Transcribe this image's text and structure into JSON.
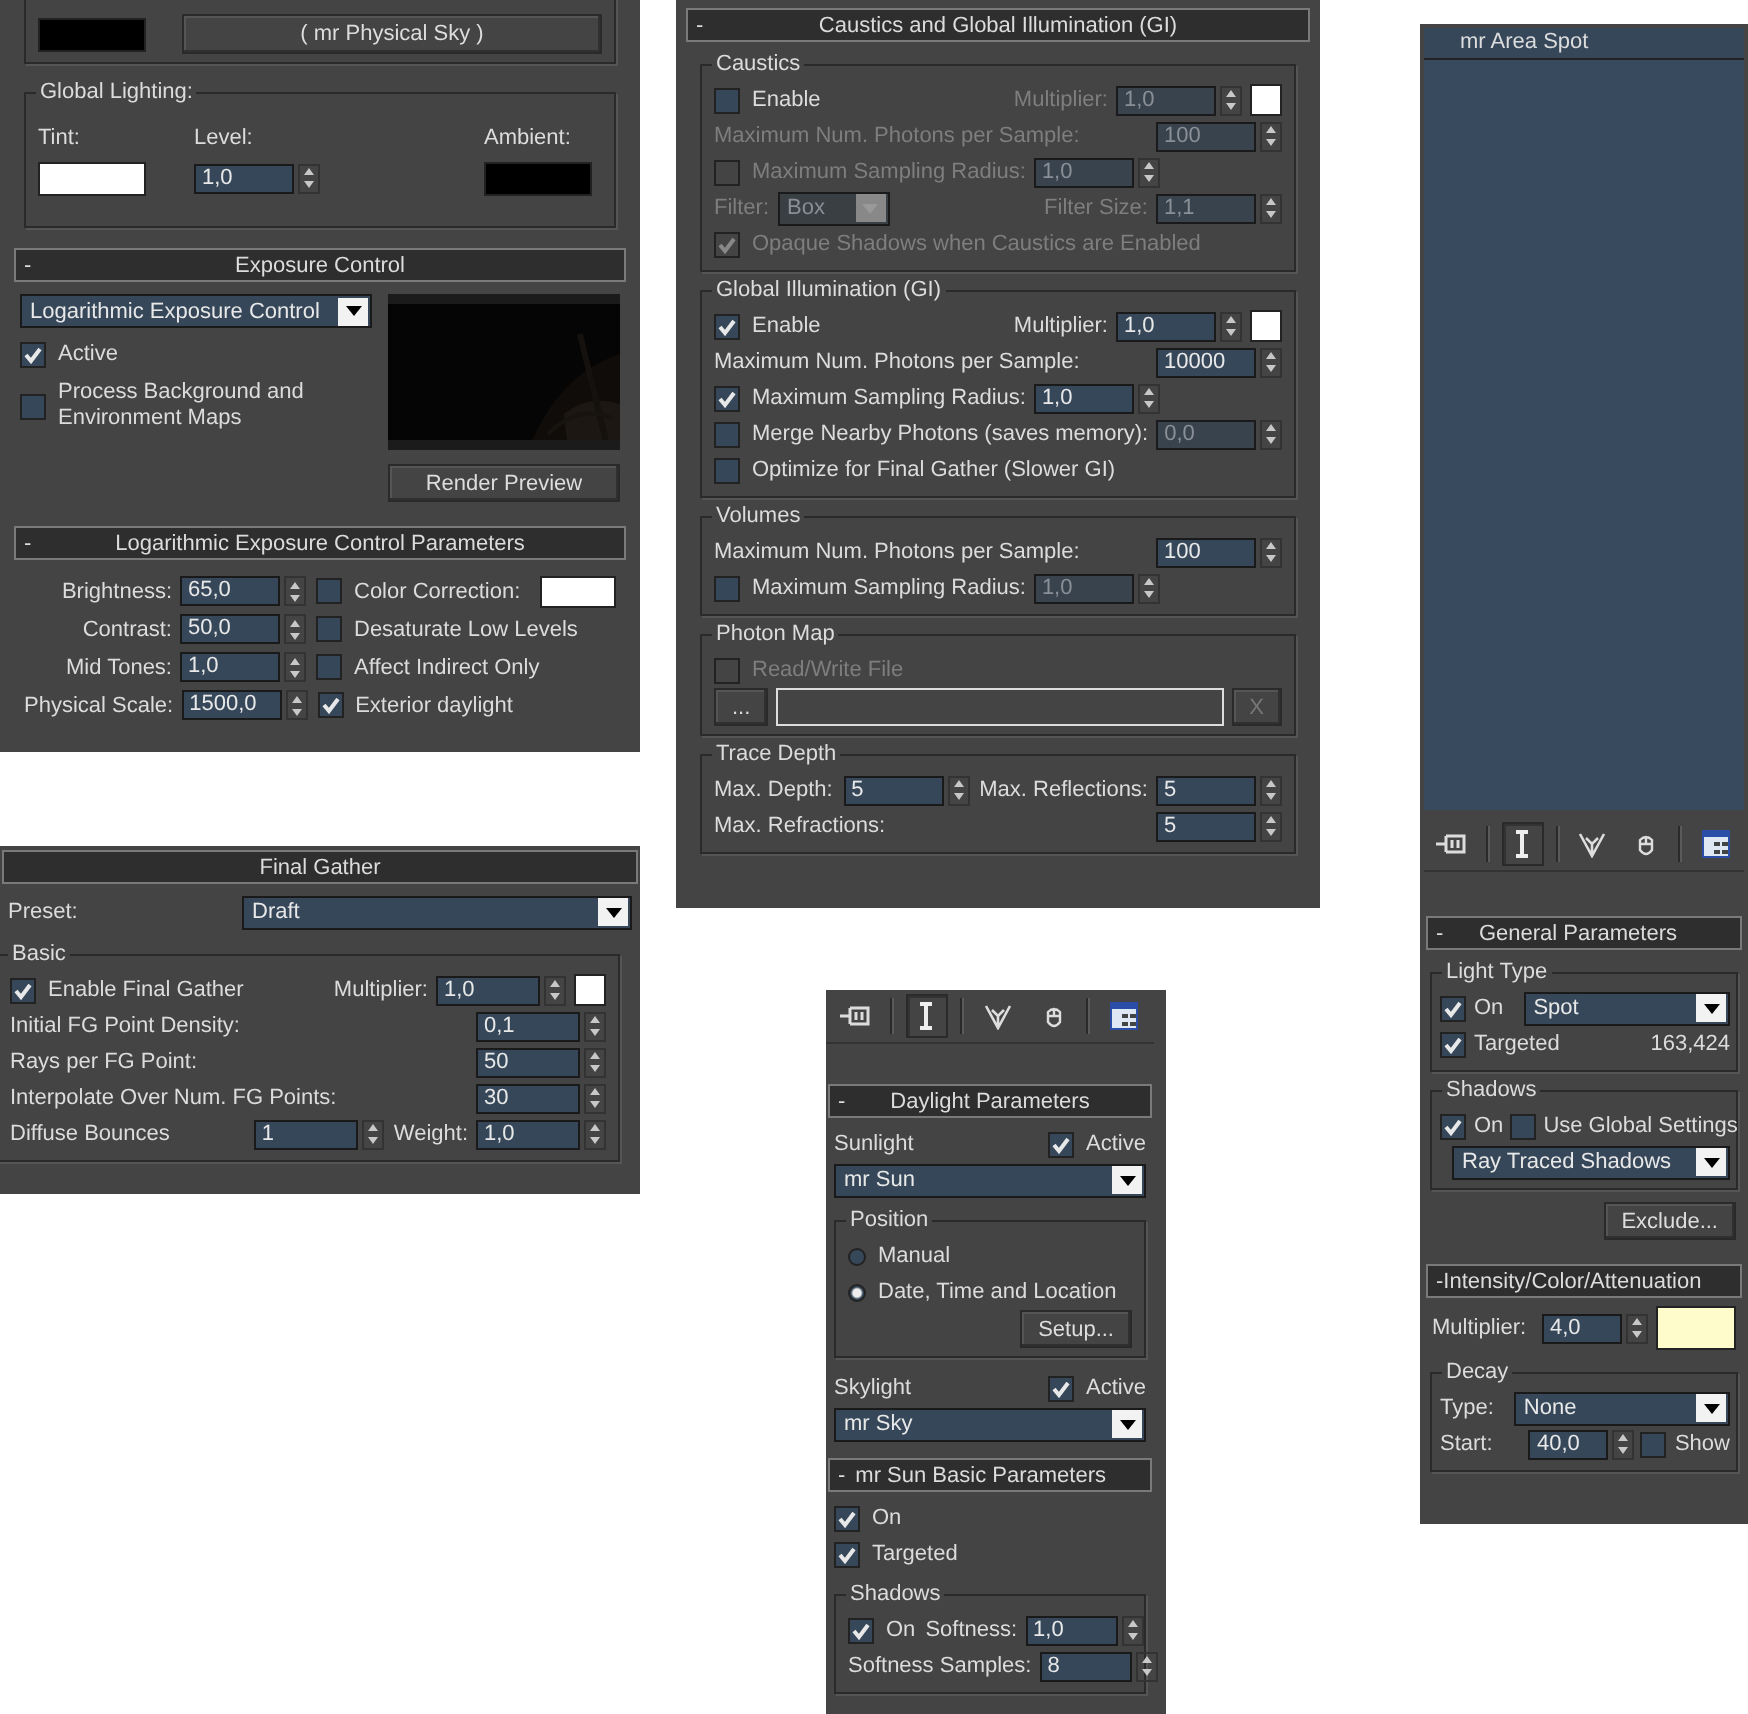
{
  "panels": [
    {
      "kind": "environment",
      "sections": [
        {
          "kind": "cut-group",
          "rows": [
            [
              {
                "kind": "swatch",
                "color": "#000000"
              },
              {
                "kind": "button",
                "label": "( mr Physical Sky )"
              }
            ]
          ]
        },
        {
          "kind": "column-group",
          "title": "Global Lighting:",
          "rows": [
            [
              {
                "kind": "label",
                "text": "Tint:"
              },
              {
                "kind": "label",
                "text": "Level:"
              },
              {
                "kind": "label",
                "text": "Ambient:"
              }
            ],
            [
              {
                "kind": "swatch",
                "color": "#ffffff"
              },
              {
                "kind": "spinner",
                "value": "1,0"
              },
              {
                "kind": "swatch",
                "color": "#000000"
              }
            ]
          ]
        },
        {
          "kind": "rollout",
          "toggle": "-",
          "title": "Exposure Control",
          "sections": [
            {
              "kind": "exposure",
              "dropdown": "Logarithmic Exposure Control",
              "options": [
                {
                  "kind": "checkbox",
                  "label": "Active",
                  "checked": true
                },
                {
                  "kind": "checkbox",
                  "label": "Process Background and Environment Maps",
                  "checked": false
                }
              ],
              "button": "Render Preview"
            }
          ]
        },
        {
          "kind": "rollout",
          "toggle": "-",
          "title": "Logarithmic Exposure Control Parameters",
          "sections": [
            {
              "kind": "pair-rows",
              "rows": [
                [
                  {
                    "kind": "label",
                    "text": "Brightness:"
                  },
                  {
                    "kind": "spinner",
                    "value": "65,0"
                  },
                  {
                    "kind": "checkbox",
                    "label": "Color Correction:",
                    "checked": false
                  },
                  {
                    "kind": "swatch",
                    "color": "#ffffff"
                  }
                ],
                [
                  {
                    "kind": "label",
                    "text": "Contrast:"
                  },
                  {
                    "kind": "spinner",
                    "value": "50,0"
                  },
                  {
                    "kind": "checkbox",
                    "label": "Desaturate Low Levels",
                    "checked": false
                  }
                ],
                [
                  {
                    "kind": "label",
                    "text": "Mid Tones:"
                  },
                  {
                    "kind": "spinner",
                    "value": "1,0"
                  },
                  {
                    "kind": "checkbox",
                    "label": "Affect Indirect Only",
                    "checked": false
                  }
                ],
                [
                  {
                    "kind": "label",
                    "text": "Physical Scale:"
                  },
                  {
                    "kind": "spinner",
                    "value": "1500,0"
                  },
                  {
                    "kind": "checkbox",
                    "label": "Exterior daylight",
                    "checked": true
                  }
                ]
              ]
            }
          ]
        }
      ]
    },
    {
      "kind": "final-gather",
      "sections": [
        {
          "kind": "rollout",
          "title": "Final Gather",
          "sections": [
            {
              "kind": "rows",
              "rows": [
                [
                  {
                    "kind": "label",
                    "text": "Preset:"
                  },
                  {
                    "kind": "dropdown",
                    "value": "Draft"
                  }
                ]
              ]
            },
            {
              "kind": "group",
              "title": "Basic",
              "rows": [
                [
                  {
                    "kind": "checkbox",
                    "label": "Enable Final Gather",
                    "checked": true
                  },
                  {
                    "kind": "label",
                    "text": "Multiplier:"
                  },
                  {
                    "kind": "spinner",
                    "value": "1,0"
                  },
                  {
                    "kind": "swatch",
                    "color": "#ffffff"
                  }
                ],
                [
                  {
                    "kind": "label",
                    "text": "Initial FG Point Density:"
                  },
                  {
                    "kind": "spinner",
                    "value": "0,1"
                  }
                ],
                [
                  {
                    "kind": "label",
                    "text": "Rays per FG Point:"
                  },
                  {
                    "kind": "spinner",
                    "value": "50"
                  }
                ],
                [
                  {
                    "kind": "label",
                    "text": "Interpolate Over Num. FG Points:"
                  },
                  {
                    "kind": "spinner",
                    "value": "30"
                  }
                ],
                [
                  {
                    "kind": "label",
                    "text": "Diffuse Bounces"
                  },
                  {
                    "kind": "spinner",
                    "value": "1"
                  },
                  {
                    "kind": "label",
                    "text": "Weight:"
                  },
                  {
                    "kind": "spinner",
                    "value": "1,0"
                  }
                ]
              ]
            }
          ]
        }
      ]
    },
    {
      "kind": "caustics",
      "sections": [
        {
          "kind": "rollout",
          "toggle": "-",
          "title": "Caustics and Global Illumination (GI)",
          "sections": [
            {
              "kind": "group",
              "title": "Caustics",
              "rows": [
                {
                  "items": [
                    {
                      "kind": "checkbox",
                      "label": "Enable",
                      "checked": false,
                      "disabled": false
                    },
                    {
                      "kind": "label",
                      "text": "Multiplier:",
                      "disabled": true
                    },
                    {
                      "kind": "spinner",
                      "value": "1,0",
                      "disabled": true
                    },
                    {
                      "kind": "swatch",
                      "color": "#ffffff"
                    }
                  ]
                },
                {
                  "items": [
                    {
                      "kind": "label",
                      "text": "Maximum Num. Photons per Sample:",
                      "disabled": true
                    },
                    {
                      "kind": "spinner",
                      "value": "100",
                      "disabled": true
                    }
                  ]
                },
                {
                  "items": [
                    {
                      "kind": "checkbox",
                      "label": "Maximum Sampling Radius:",
                      "checked": false,
                      "disabled": true
                    },
                    {
                      "kind": "spinner",
                      "value": "1,0",
                      "disabled": true
                    }
                  ]
                },
                {
                  "items": [
                    {
                      "kind": "label",
                      "text": "Filter:",
                      "disabled": true
                    },
                    {
                      "kind": "dropdown",
                      "value": "Box",
                      "disabled": true
                    },
                    {
                      "kind": "label",
                      "text": "Filter Size:",
                      "disabled": true
                    },
                    {
                      "kind": "spinner",
                      "value": "1,1",
                      "disabled": true
                    }
                  ]
                },
                {
                  "items": [
                    {
                      "kind": "checkbox",
                      "label": "Opaque Shadows when Caustics are Enabled",
                      "checked": true,
                      "disabled": true
                    }
                  ]
                }
              ]
            },
            {
              "kind": "group",
              "title": "Global Illumination (GI)",
              "rows": [
                {
                  "items": [
                    {
                      "kind": "checkbox",
                      "label": "Enable",
                      "checked": true,
                      "disabled": false
                    },
                    {
                      "kind": "label",
                      "text": "Multiplier:",
                      "disabled": false
                    },
                    {
                      "kind": "spinner",
                      "value": "1,0",
                      "disabled": false
                    },
                    {
                      "kind": "swatch",
                      "color": "#ffffff"
                    }
                  ]
                },
                {
                  "items": [
                    {
                      "kind": "label",
                      "text": "Maximum Num. Photons per Sample:",
                      "disabled": false
                    },
                    {
                      "kind": "spinner",
                      "value": "10000",
                      "disabled": false
                    }
                  ]
                },
                {
                  "items": [
                    {
                      "kind": "checkbox",
                      "label": "Maximum Sampling Radius:",
                      "checked": true,
                      "disabled": false
                    },
                    {
                      "kind": "spinner",
                      "value": "1,0",
                      "disabled": false
                    }
                  ]
                },
                {
                  "items": [
                    {
                      "kind": "checkbox",
                      "label": "Merge Nearby Photons (saves memory):",
                      "checked": false,
                      "disabled": false
                    },
                    {
                      "kind": "spinner",
                      "value": "0,0",
                      "disabled": true
                    }
                  ]
                },
                {
                  "items": [
                    {
                      "kind": "checkbox",
                      "label": "Optimize for Final Gather (Slower GI)",
                      "checked": false,
                      "disabled": false
                    }
                  ]
                }
              ]
            },
            {
              "kind": "group",
              "title": "Volumes",
              "rows": [
                {
                  "items": [
                    {
                      "kind": "label",
                      "text": "Maximum Num. Photons per Sample:",
                      "disabled": false
                    },
                    {
                      "kind": "spinner",
                      "value": "100",
                      "disabled": false
                    }
                  ]
                },
                {
                  "items": [
                    {
                      "kind": "checkbox",
                      "label": "Maximum Sampling Radius:",
                      "checked": false,
                      "disabled": false
                    },
                    {
                      "kind": "spinner",
                      "value": "1,0",
                      "disabled": true
                    }
                  ]
                }
              ]
            },
            {
              "kind": "group",
              "title": "Photon Map",
              "rows": [
                [
                  {
                    "kind": "checkbox",
                    "label": "Read/Write File",
                    "checked": false,
                    "disabled": true
                  }
                ],
                [
                  {
                    "kind": "button",
                    "label": "...",
                    "disabled": false
                  },
                  {
                    "kind": "field"
                  },
                  {
                    "kind": "button",
                    "label": "X",
                    "disabled": true
                  }
                ]
              ]
            },
            {
              "kind": "group",
              "title": "Trace Depth",
              "rows": [
                {
                  "items": [
                    {
                      "kind": "label",
                      "text": "Max. Depth:",
                      "disabled": false
                    },
                    {
                      "kind": "spinner",
                      "value": "5",
                      "disabled": false
                    },
                    {
                      "kind": "label",
                      "text": "Max. Reflections:",
                      "disabled": false
                    },
                    {
                      "kind": "spinner",
                      "value": "5",
                      "disabled": false
                    }
                  ]
                },
                {
                  "items": [
                    {
                      "kind": "label",
                      "text": "Max. Refractions:",
                      "disabled": false
                    },
                    {
                      "kind": "spinner",
                      "value": "5",
                      "disabled": false
                    }
                  ]
                }
              ]
            }
          ]
        }
      ]
    },
    {
      "kind": "daylight",
      "sections": [
        {
          "kind": "toolbar",
          "buttons": [
            {
              "selected": false
            },
            {
              "selected": true
            },
            {
              "selected": false
            },
            {
              "selected": false
            },
            {
              "selected": false
            }
          ]
        },
        {
          "kind": "rollout",
          "toggle": "-",
          "title": "Daylight Parameters",
          "sections": [
            {
              "kind": "rows",
              "rows": [
                [
                  {
                    "kind": "label",
                    "text": "Sunlight"
                  },
                  {
                    "kind": "checkbox",
                    "label": "Active",
                    "checked": true
                  }
                ],
                [
                  {
                    "kind": "dropdown",
                    "value": "mr Sun"
                  }
                ]
              ]
            },
            {
              "kind": "group",
              "title": "Position",
              "rows": [
                [
                  {
                    "kind": "radio",
                    "label": "Manual",
                    "selected": false
                  }
                ],
                [
                  {
                    "kind": "radio",
                    "label": "Date, Time and Location",
                    "selected": true
                  }
                ],
                [
                  {
                    "kind": "button",
                    "label": "Setup..."
                  }
                ]
              ]
            },
            {
              "kind": "rows",
              "rows": [
                [
                  {
                    "kind": "label",
                    "text": "Skylight"
                  },
                  {
                    "kind": "checkbox",
                    "label": "Active",
                    "checked": true
                  }
                ],
                [
                  {
                    "kind": "dropdown",
                    "value": "mr Sky"
                  }
                ]
              ]
            }
          ]
        },
        {
          "kind": "rollout",
          "toggle": "-",
          "title": "mr Sun Basic Parameters",
          "sections": [
            {
              "kind": "rows",
              "rows": [
                [
                  {
                    "kind": "checkbox",
                    "label": "On",
                    "checked": true
                  }
                ],
                [
                  {
                    "kind": "checkbox",
                    "label": "Targeted",
                    "checked": true
                  }
                ]
              ]
            },
            {
              "kind": "group",
              "title": "Shadows",
              "rows": [
                {
                  "items": [
                    {
                      "kind": "checkbox",
                      "label": "On",
                      "checked": true
                    },
                    {
                      "kind": "label",
                      "text": "Softness:"
                    },
                    {
                      "kind": "spinner",
                      "value": "1,0"
                    }
                  ]
                },
                {
                  "items": [
                    {
                      "kind": "label",
                      "text": "Softness Samples:"
                    },
                    {
                      "kind": "spinner",
                      "value": "8"
                    }
                  ]
                }
              ]
            }
          ]
        }
      ]
    },
    {
      "kind": "light",
      "sections": [
        {
          "kind": "object-name",
          "value": "mr Area Spot"
        },
        {
          "kind": "toolbar",
          "buttons": [
            {
              "selected": false
            },
            {
              "selected": true
            },
            {
              "selected": false
            },
            {
              "selected": false
            },
            {
              "selected": false
            }
          ]
        },
        {
          "kind": "rollout",
          "toggle": "-",
          "title": "General Parameters",
          "sections": [
            {
              "kind": "group",
              "title": "Light Type",
              "rows": [
                [
                  {
                    "kind": "checkbox",
                    "label": "On",
                    "checked": true
                  },
                  {
                    "kind": "dropdown",
                    "value": "Spot"
                  }
                ],
                [
                  {
                    "kind": "checkbox",
                    "label": "Targeted",
                    "checked": true
                  },
                  {
                    "kind": "label",
                    "text": "163,424"
                  }
                ]
              ]
            },
            {
              "kind": "group",
              "title": "Shadows",
              "rows": [
                [
                  {
                    "kind": "checkbox",
                    "label": "On",
                    "checked": true
                  },
                  {
                    "kind": "checkbox",
                    "label": "Use Global Settings",
                    "checked": false
                  }
                ],
                [
                  {
                    "kind": "dropdown",
                    "value": "Ray Traced Shadows"
                  }
                ]
              ]
            },
            {
              "kind": "rows",
              "rows": [
                [
                  {
                    "kind": "button",
                    "label": "Exclude..."
                  }
                ]
              ]
            }
          ]
        },
        {
          "kind": "rollout",
          "toggle": "-",
          "title": "Intensity/Color/Attenuation",
          "sections": [
            {
              "kind": "rows",
              "rows": [
                [
                  {
                    "kind": "label",
                    "text": "Multiplier:"
                  },
                  {
                    "kind": "spinner",
                    "value": "4,0"
                  },
                  {
                    "kind": "swatch",
                    "color": "#fffccc"
                  }
                ]
              ]
            },
            {
              "kind": "group",
              "title": "Decay",
              "rows": [
                [
                  {
                    "kind": "label",
                    "text": "Type:"
                  },
                  {
                    "kind": "dropdown",
                    "value": "None"
                  }
                ],
                [
                  {
                    "kind": "label",
                    "text": "Start:"
                  },
                  {
                    "kind": "spinner",
                    "value": "40,0"
                  },
                  {
                    "kind": "checkbox",
                    "label": "Show",
                    "checked": false
                  }
                ]
              ]
            }
          ]
        }
      ]
    }
  ]
}
